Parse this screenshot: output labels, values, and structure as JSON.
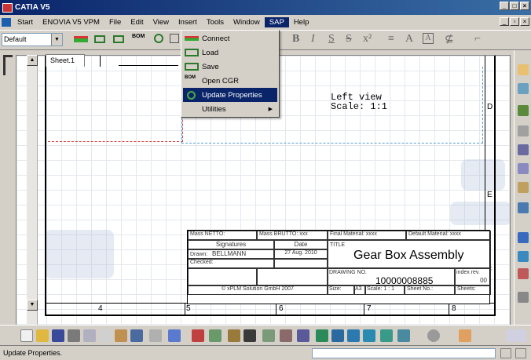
{
  "window": {
    "title": "CATIA V5"
  },
  "menubar": [
    "Start",
    "ENOVIA V5 VPM",
    "File",
    "Edit",
    "View",
    "Insert",
    "Tools",
    "Window",
    "SAP",
    "Help"
  ],
  "active_menu": "SAP",
  "toolbar": {
    "style_value": "Default",
    "xplm_labels": [
      "xPLM",
      "xPLM",
      "xPLM",
      "xPLM",
      "xPLM"
    ],
    "bom_label": "BOM"
  },
  "sap_menu": {
    "items": [
      {
        "label": "Connect",
        "icon": "xplm-connect-icon",
        "badge": "xPLM"
      },
      {
        "label": "Load",
        "icon": "xplm-load-icon",
        "badge": "xPLM"
      },
      {
        "label": "Save",
        "icon": "xplm-save-icon",
        "badge": "xPLM"
      },
      {
        "label": "Open CGR",
        "icon": "bom-icon",
        "badge": "BOM\nxPLM"
      },
      {
        "label": "Update Properties",
        "icon": "update-icon",
        "selected": true
      },
      {
        "label": "Utilities",
        "icon": "",
        "submenu": true
      }
    ]
  },
  "sheet": {
    "tab": "Sheet.1"
  },
  "drawing": {
    "view_label": "Left view",
    "scale_label": "Scale:  1:1",
    "zones_right": [
      "D",
      "E",
      "F"
    ],
    "zones_bottom": [
      "4",
      "5",
      "6",
      "7",
      "8"
    ]
  },
  "title_block": {
    "mass_netto": "Mass NETTO:",
    "mass_brutto": "Mass BRUTTO:",
    "mass_brutto_val": "xxx",
    "final_material": "Final Material:",
    "final_material_val": "xxxx",
    "default_material": "Default Material:",
    "default_material_val": "xxxx",
    "signatures": "Signatures",
    "date": "Date",
    "title_label": "TITLE",
    "title": "Gear Box Assembly",
    "drawn_label": "Drawn:",
    "drawn_name": "BELLMANN",
    "drawn_date": "27 Aug. 2010",
    "checked_label": "Checked:",
    "drawing_no_label": "DRAWING NO.",
    "drawing_no": "10000008885",
    "index_label": "index rev.",
    "index_val": "00",
    "copyright": "© xPLM Solution GmbH 2007",
    "size_label": "Size:",
    "size_val": "A3",
    "scale_label": "Scale:",
    "scale_val": "1 : 1",
    "sheet_no_label": "Sheet No.:",
    "sheets_label": "Sheets:"
  },
  "status": {
    "text": "Update Properties."
  }
}
